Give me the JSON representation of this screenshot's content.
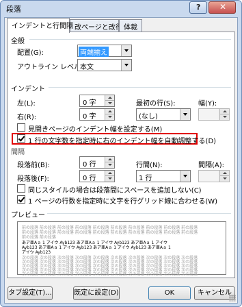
{
  "window": {
    "title": "段落",
    "help": "?",
    "close": "✕"
  },
  "tabs": [
    "インデントと行間隔",
    "改ページと改行",
    "体裁"
  ],
  "general": {
    "label": "全般",
    "alignment_label": "配置(G):",
    "alignment_value": "両端揃え",
    "outline_label": "アウトライン レベル(O):",
    "outline_value": "本文"
  },
  "indent": {
    "label": "インデント",
    "left_label": "左(L):",
    "left_value": "0 字",
    "right_label": "右(R):",
    "right_value": "0 字",
    "first_line_label": "最初の行(S):",
    "first_line_value": "(なし)",
    "width_label": "幅(Y):",
    "width_value": "",
    "mirror_label": "見開きページのインデント幅を設定する(M)",
    "auto_adjust_label": "1 行の文字数を指定時に右のインデント幅を自動調整する(D)"
  },
  "spacing": {
    "label": "間隔",
    "before_label": "段落前(B):",
    "before_value": "0 行",
    "after_label": "段落後(F):",
    "after_value": "0 行",
    "line_spacing_label": "行間(N):",
    "line_spacing_value": "1 行",
    "at_label": "間隔(A):",
    "at_value": "",
    "no_space_label": "同じスタイルの場合は段落間にスペースを追加しない(C)",
    "snap_grid_label": "1 ページの行数を指定時に文字を行グリッド線に合わせる(W)"
  },
  "preview": {
    "label": "プレビュー",
    "prev_lines": [
      "前の段落 前の段落 前の段落 前の段落 前の段落 前の段落 前の段落 前の段落 前の段落 前の段落",
      "前の段落 前の段落 前の段落 前の段落 前の段落 前の段落 前の段落 前の段落 前の段落 前の段落",
      "前の段落 前の段落"
    ],
    "sample_lines": [
      "あア亜Aａ 1 アイウ Ayb123 あア亜Aａ 1 アイウ Ayb123 あア亜Aａ 1 アイウ",
      "Ayb123 あア亜Aａ 1 アイウ Ayb123 あア亜Aａ 1 アイウ Ayb123 あア亜Aａ 1",
      "アイウ Ayb123"
    ],
    "next_lines": [
      "次の段落 次の段落 次の段落 次の段落 次の段落 次の段落 次の段落 次の段落 次の段落 次の段落",
      "次の段落 次の段落 次の段落 次の段落 次の段落 次の段落 次の段落 次の段落 次の段落 次の段落",
      "次の段落 次の段落 次の段落 次の段落 次の段落 次の段落 次の段落 次の段落 次の段落 次の段落",
      "次の段落 次の段落 次の段落 次の段落 次の段落 次の段落 次の段落 次の段落 次の段落 次の段落",
      "次の段落 次の段落 次の段落 次の段落 次の段落 次の段落 次の段落 次の段落 次の段落 次の段落"
    ]
  },
  "buttons": {
    "tabs": "タブ設定(T)...",
    "default": "既定に設定(D)",
    "ok": "OK",
    "cancel": "キャンセル"
  },
  "colors": {
    "highlight": "#e00000",
    "selection": "#3399ff"
  }
}
